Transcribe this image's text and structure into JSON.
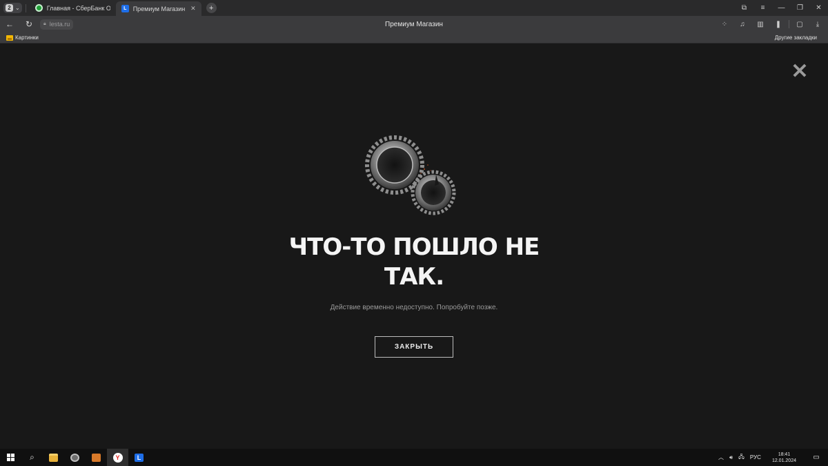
{
  "browser": {
    "tab_count": "2",
    "tabs": [
      {
        "title": "Главная - СберБанк Онлайн",
        "favicon": "sber-icon",
        "active": false
      },
      {
        "title": "Премиум Магазин",
        "favicon": "lesta-icon",
        "active": true
      }
    ],
    "url": "lesta.ru",
    "page_title": "Премиум Магазин",
    "bookmarks": {
      "item": "Картинки",
      "other": "Другие закладки"
    }
  },
  "dialog": {
    "title": "ЧТО-ТО ПОШЛО НЕ ТАК.",
    "message": "Действие временно недоступно. Попробуйте позже.",
    "close_button": "ЗАКРЫТЬ",
    "illustration": "broken-gears"
  },
  "taskbar": {
    "language": "РУС",
    "time": "18:41",
    "date": "12.01.2024"
  },
  "colors": {
    "background": "#181818",
    "text": "#f4f4f4",
    "muted_text": "#9b9b9b",
    "lesta_blue": "#1e6ee8"
  }
}
